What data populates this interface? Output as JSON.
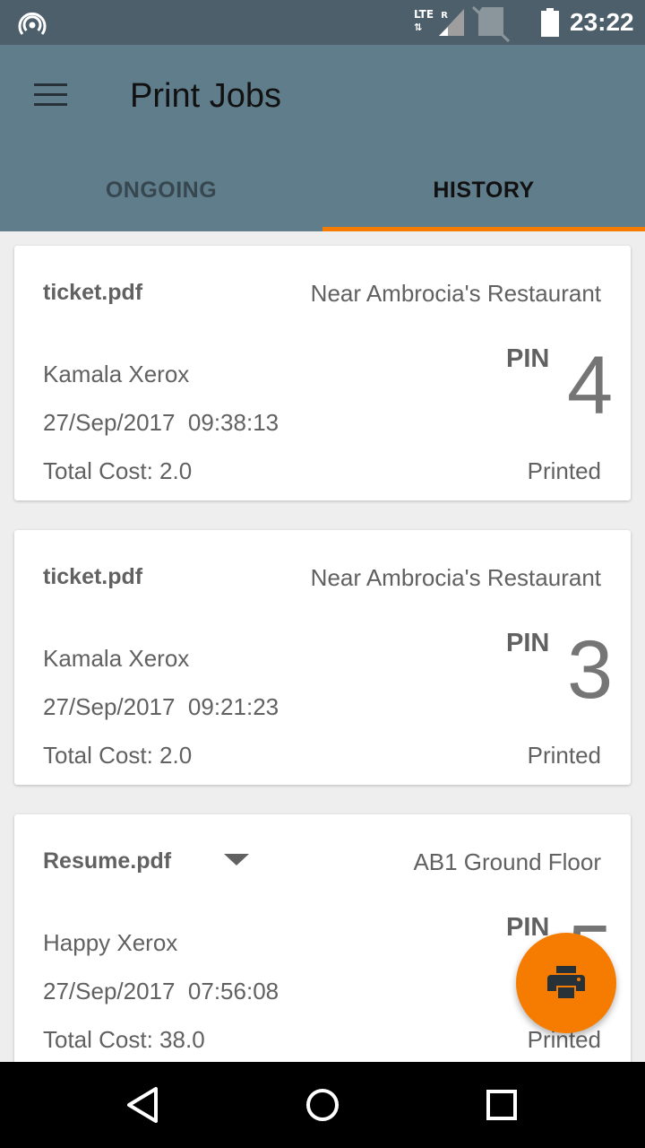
{
  "status_bar": {
    "network": "LTE",
    "roaming": "R",
    "time": "23:22",
    "icons": [
      "hotspot-icon",
      "signal-icon",
      "no-sim-icon",
      "battery-icon"
    ]
  },
  "app_bar": {
    "title": "Print Jobs",
    "menu_icon": "hamburger-menu-icon"
  },
  "tabs": [
    {
      "label": "ONGOING",
      "active": false
    },
    {
      "label": "HISTORY",
      "active": true
    }
  ],
  "jobs": [
    {
      "file": "ticket.pdf",
      "location": "Near Ambrocia's Restaurant",
      "shop": "Kamala Xerox",
      "datetime": "27/Sep/2017  09:38:13",
      "cost": "Total Cost: 2.0",
      "status": "Printed",
      "pin_label": "PIN",
      "pin": "4"
    },
    {
      "file": "ticket.pdf",
      "location": "Near Ambrocia's Restaurant",
      "shop": "Kamala Xerox",
      "datetime": "27/Sep/2017  09:21:23",
      "cost": "Total Cost: 2.0",
      "status": "Printed",
      "pin_label": "PIN",
      "pin": "3"
    },
    {
      "file": "Resume.pdf",
      "location": "AB1 Ground Floor",
      "shop": "Happy Xerox",
      "datetime": "27/Sep/2017  07:56:08",
      "cost": "Total Cost: 38.0",
      "status": "Printed",
      "pin_label": "PIN",
      "pin": "5"
    }
  ],
  "fab": {
    "icon": "printer-icon"
  },
  "colors": {
    "status_bar": "#4d5f6b",
    "app_bar": "#607d8b",
    "accent": "#f57c00",
    "background": "#eeeeee"
  },
  "nav_bar": {
    "icons": [
      "back-icon",
      "home-icon",
      "recents-icon"
    ]
  }
}
